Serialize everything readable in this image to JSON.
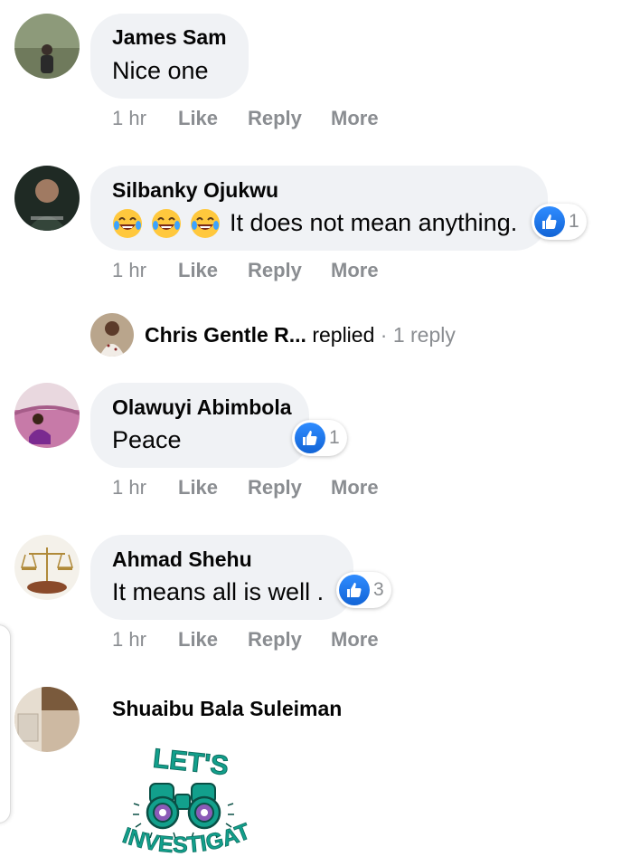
{
  "comments": [
    {
      "author": "James Sam",
      "text": "Nice one",
      "time": "1 hr",
      "actions": {
        "like": "Like",
        "reply": "Reply",
        "more": "More"
      }
    },
    {
      "author": "Silbanky Ojukwu",
      "emojis": [
        "joy-emoji",
        "joy-emoji",
        "joy-emoji"
      ],
      "text": "It does not mean anything.",
      "reaction_count": "1",
      "time": "1 hr",
      "actions": {
        "like": "Like",
        "reply": "Reply",
        "more": "More"
      },
      "replies": {
        "author": "Chris Gentle R...",
        "verb": "replied",
        "separator": "·",
        "count": "1 reply"
      }
    },
    {
      "author": "Olawuyi Abimbola",
      "text": "Peace",
      "reaction_count": "1",
      "time": "1 hr",
      "actions": {
        "like": "Like",
        "reply": "Reply",
        "more": "More"
      }
    },
    {
      "author": "Ahmad Shehu",
      "text": "It means all is well .",
      "reaction_count": "3",
      "time": "1 hr",
      "actions": {
        "like": "Like",
        "reply": "Reply",
        "more": "More"
      }
    },
    {
      "author": "Shuaibu Bala Suleiman",
      "sticker": {
        "line1": "LET'S",
        "line2": "INVESTIGATE"
      }
    }
  ],
  "colors": {
    "bubble": "#f0f2f5",
    "meta_text": "#8a8d91",
    "like_blue": "#1877f2",
    "sticker_teal": "#12a08c",
    "sticker_purple": "#8b5bb8"
  },
  "icons": {
    "reaction": "thumbs-up-icon"
  }
}
